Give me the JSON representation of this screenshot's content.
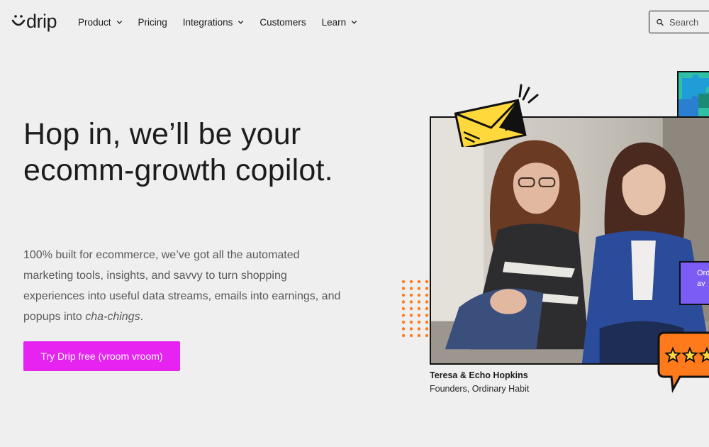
{
  "brand": {
    "name": "drip",
    "accent": "#e623f0"
  },
  "nav": {
    "items": [
      {
        "label": "Product",
        "has_dropdown": true
      },
      {
        "label": "Pricing",
        "has_dropdown": false
      },
      {
        "label": "Integrations",
        "has_dropdown": true
      },
      {
        "label": "Customers",
        "has_dropdown": false
      },
      {
        "label": "Learn",
        "has_dropdown": true
      }
    ],
    "search_placeholder": "Search"
  },
  "hero": {
    "headline": "Hop in, we’ll be your ecomm-growth copilot.",
    "body_prefix": "100% built for ecommerce, we’ve got all the automated marketing tools, insights, and savvy to turn shopping experiences into useful data streams, emails into earnings, and popups into ",
    "body_emphasis": "cha-chings",
    "body_suffix": ".",
    "cta_label": "Try Drip free (vroom vroom)"
  },
  "testimonial": {
    "name": "Teresa & Echo Hopkins",
    "role": "Founders, Ordinary Habit",
    "promo_tag_text": [
      "Ord",
      "av"
    ],
    "rating_stars": 3
  },
  "icons": {
    "logo": "drip-smile-icon",
    "search": "search-icon",
    "dropdown": "chevron-down-icon",
    "envelope": "envelope-icon",
    "star": "star-icon"
  }
}
